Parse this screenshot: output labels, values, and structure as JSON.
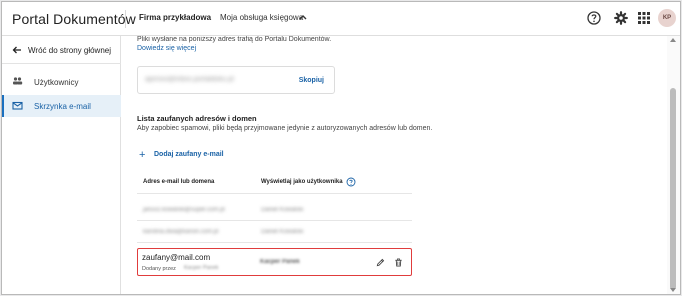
{
  "header": {
    "app_title": "Portal Dokumentów",
    "company": "Firma przykładowa",
    "accounting": "Moja obsługa księgowa",
    "avatar_initials": "KP",
    "icons": [
      "help-icon",
      "gear-icon",
      "apps-grid-icon"
    ]
  },
  "sidebar": {
    "back_label": "Wróć do strony głównej",
    "items": [
      {
        "label": "Użytkownicy",
        "icon": "users-icon",
        "active": false
      },
      {
        "label": "Skrzynka e-mail",
        "icon": "mail-icon",
        "active": true
      }
    ]
  },
  "main": {
    "info_text": "Pliki wysłane na poniższy adres trafią do Portalu Dokumentów.",
    "learn_more": "Dowiedz się więcej",
    "inbox_address_blurred": "apimoo@inbox.portaldoku.pl",
    "copy_label": "Skopiuj",
    "trusted_title": "Lista zaufanych adresów i domen",
    "trusted_desc": "Aby zapobiec spamowi, pliki będą przyjmowane jedynie z autoryzowanych adresów lub domen.",
    "add_label": "Dodaj zaufany e-mail",
    "table": {
      "col_email": "Adres e-mail lub domena",
      "col_user": "Wyświetlaj jako użytkownika",
      "blurred_rows": [
        {
          "email": "janusz.kowalski@super.com.pl",
          "user": "Daniel Kowalski"
        },
        {
          "email": "karolina.dwa@kanon.com.pl",
          "user": "Daniel Kowalski"
        }
      ],
      "highlighted_row": {
        "email": "zaufany@mail.com",
        "added_by_label": "Dodany przez",
        "added_by_blurred": "Kacper Panek",
        "user_blurred": "Kacper Panek"
      }
    }
  },
  "colors": {
    "accent": "#1a62a6",
    "highlight_border": "#e03c3c",
    "active_bg": "#e6f0f8"
  }
}
